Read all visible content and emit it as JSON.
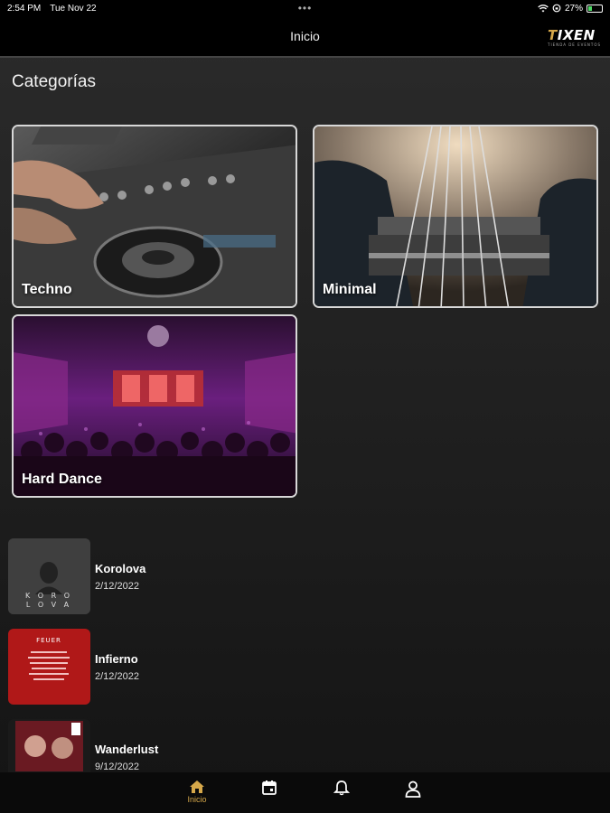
{
  "status": {
    "time": "2:54 PM",
    "date": "Tue Nov 22",
    "dots": "•••",
    "battery": "27%",
    "battery_level": 0.27
  },
  "header": {
    "title": "Inicio",
    "logo_initial": "T",
    "logo_rest": "IXEN",
    "logo_sub": "TIENDA DE EVENTOS"
  },
  "section_title": "Categorías",
  "categories": [
    {
      "label": "Techno"
    },
    {
      "label": "Minimal"
    },
    {
      "label": "Hard Dance"
    }
  ],
  "events": [
    {
      "name": "Korolova",
      "date": "2/12/2022"
    },
    {
      "name": "Infierno",
      "date": "2/12/2022"
    },
    {
      "name": "Wanderlust",
      "date": "9/12/2022"
    }
  ],
  "nav": {
    "home_label": "Inicio",
    "accent": "#d6a84a"
  }
}
